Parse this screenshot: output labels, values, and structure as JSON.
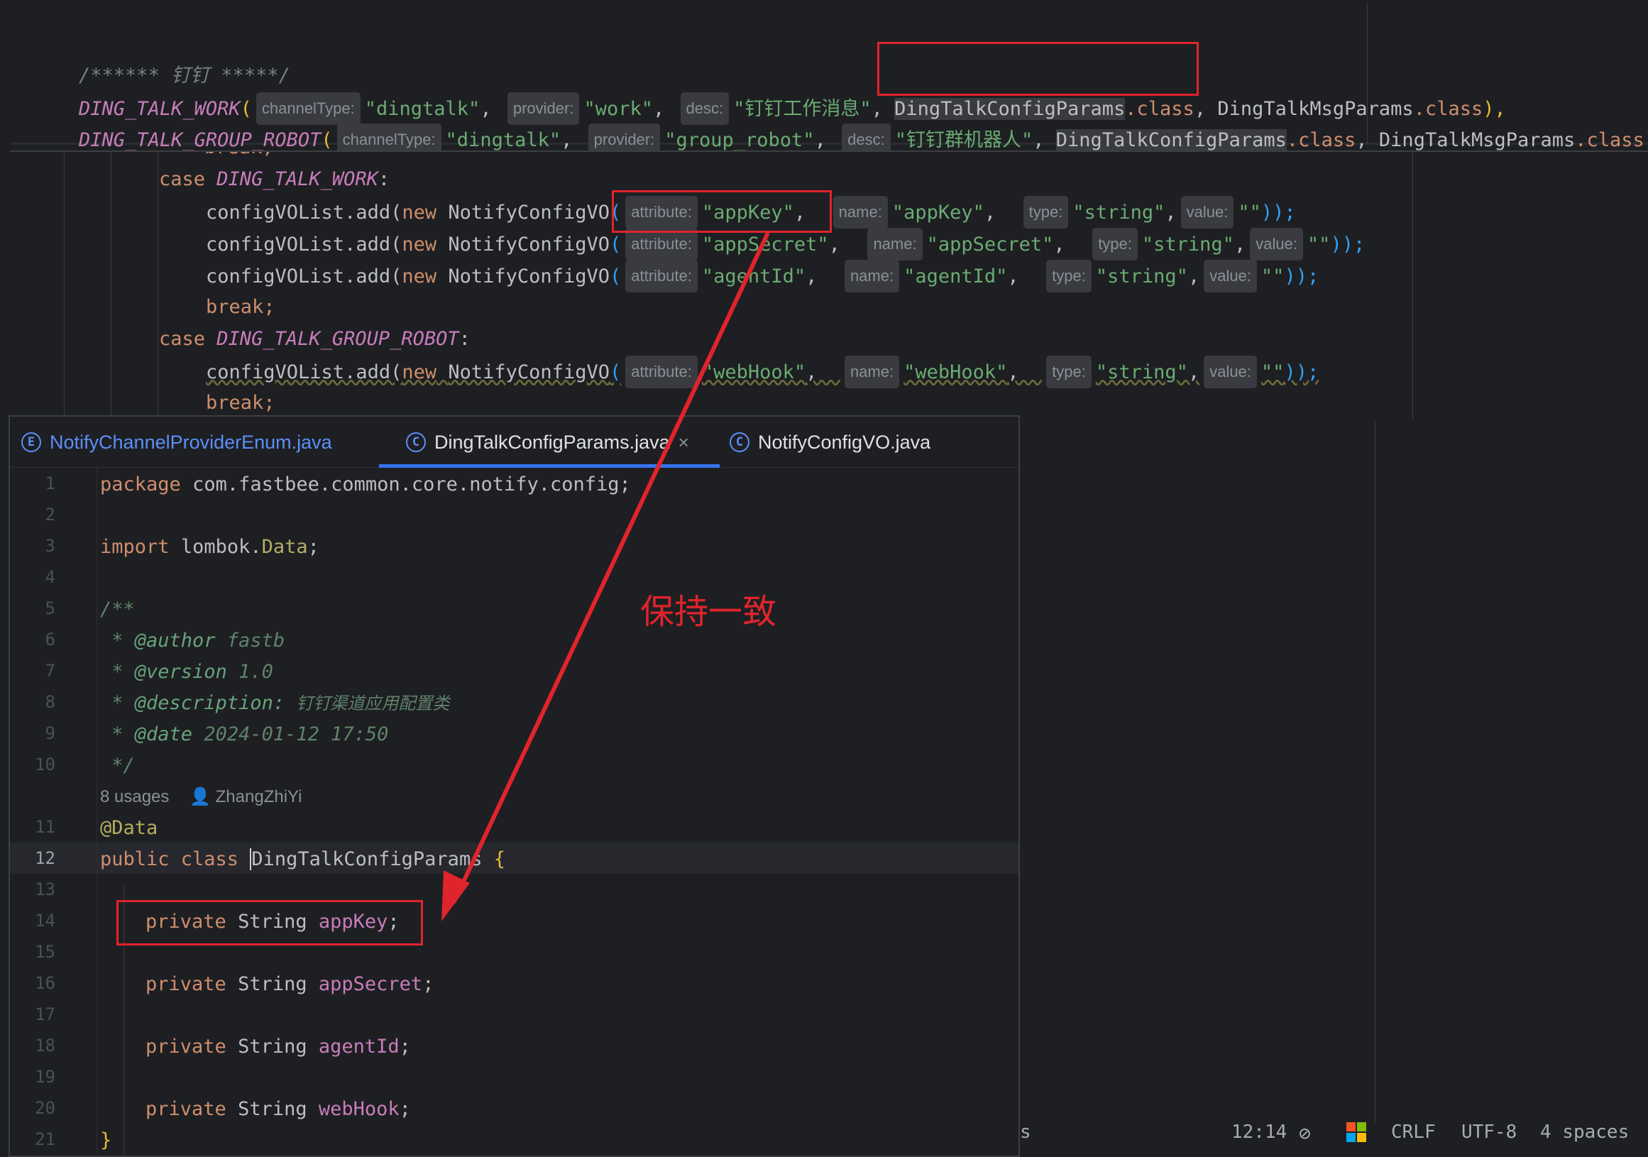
{
  "top": {
    "comment": "/****** 钉钉 *****/",
    "row1": {
      "name": "DING_TALK_WORK",
      "open": "(",
      "hint1": "channelType:",
      "v1": "\"dingtalk\"",
      "c1": ",",
      "hint2": "provider:",
      "v2": "\"work\"",
      "c2": ",",
      "hint3": "desc:",
      "v3": "\"钉钉工作消息\"",
      "c3": ",",
      "cls1": "DingTalkConfigParams",
      "cls1_ext": ".class",
      "c4": ",",
      "cls2": "DingTalkMsgParams",
      "cls2_ext": ".class",
      "close": "),"
    },
    "row2": {
      "name": "DING_TALK_GROUP_ROBOT",
      "open": "(",
      "hint1": "channelType:",
      "v1": "\"dingtalk\"",
      "c1": ",",
      "hint2": "provider:",
      "v2": "\"group_robot\"",
      "c2": ",",
      "hint3": "desc:",
      "v3": "\"钉钉群机器人\"",
      "c3": ",",
      "cls1": "DingTalkConfigParams",
      "cls1_ext": ".class",
      "c4": ",",
      "cls2": "DingTalkMsgParams",
      "cls2_ext": ".class",
      "close": ");"
    }
  },
  "middle": {
    "break_top": "break;",
    "case1_kw": "case",
    "case1_name": "DING_TALK_WORK",
    "colon": ":",
    "add_prefix": "configVOList.add(",
    "new_kw": "new",
    "ctor": "NotifyConfigVO",
    "hint_attr": "attribute:",
    "hint_name": "name:",
    "hint_type": "type:",
    "hint_value": "value:",
    "rows_work": [
      {
        "attr": "\"appKey\"",
        "name": "\"appKey\"",
        "type": "\"string\"",
        "value": "\"\"",
        "end": "));"
      },
      {
        "attr": "\"appSecret\"",
        "name": "\"appSecret\"",
        "type": "\"string\"",
        "value": "\"\"",
        "end": "));"
      },
      {
        "attr": "\"agentId\"",
        "name": "\"agentId\"",
        "type": "\"string\"",
        "value": "\"\"",
        "end": "));"
      }
    ],
    "break_kw": "break;",
    "case2_name": "DING_TALK_GROUP_ROBOT",
    "row_robot": {
      "attr": "\"webHook\"",
      "name": "\"webHook\"",
      "type": "\"string\"",
      "value": "\"\"",
      "end": "));"
    },
    "break_bottom": "break;"
  },
  "tabs": [
    {
      "icon": "E",
      "label": "NotifyChannelProviderEnum.java"
    },
    {
      "icon": "C",
      "label": "DingTalkConfigParams.java",
      "close": "×"
    },
    {
      "icon": "C",
      "label": "NotifyConfigVO.java"
    }
  ],
  "editor": {
    "line_numbers": [
      "1",
      "2",
      "3",
      "4",
      "5",
      "6",
      "7",
      "8",
      "9",
      "10",
      "11",
      "12",
      "13",
      "14",
      "15",
      "16",
      "17",
      "18",
      "19",
      "20",
      "21"
    ],
    "pkg_kw": "package",
    "pkg_name": "com.fastbee.common.core.notify.config;",
    "import_kw": "import",
    "import_pkg": "lombok.",
    "import_cls": "Data",
    "import_end": ";",
    "doc_open": "/**",
    "doc_author_tag": "@author",
    "doc_author": "fastb",
    "doc_version_tag": "@version",
    "doc_version": "1.0",
    "doc_desc_tag": "@description:",
    "doc_desc": "钉钉渠道应用配置类",
    "doc_date_tag": "@date",
    "doc_date": "2024-01-12 17:50",
    "doc_close": "*/",
    "usages": "8 usages",
    "author": "ZhangZhiYi",
    "annotation": "@Data",
    "class_kw": "public class",
    "class_name": "DingTalkConfigParams",
    "brace_open": "{",
    "fields": [
      {
        "kw": "private",
        "type": "String",
        "name": "appKey",
        "end": ";"
      },
      {
        "kw": "private",
        "type": "String",
        "name": "appSecret",
        "end": ";"
      },
      {
        "kw": "private",
        "type": "String",
        "name": "agentId",
        "end": ";"
      },
      {
        "kw": "private",
        "type": "String",
        "name": "webHook",
        "end": ";"
      }
    ],
    "brace_close": "}"
  },
  "annotation_note": "保持一致",
  "status": {
    "tail": "s",
    "position": "12:14",
    "line_sep": "CRLF",
    "encoding": "UTF-8",
    "indent": "4 spaces"
  },
  "colors": {
    "red_marker": "#e0242b",
    "accent": "#3574f0"
  }
}
